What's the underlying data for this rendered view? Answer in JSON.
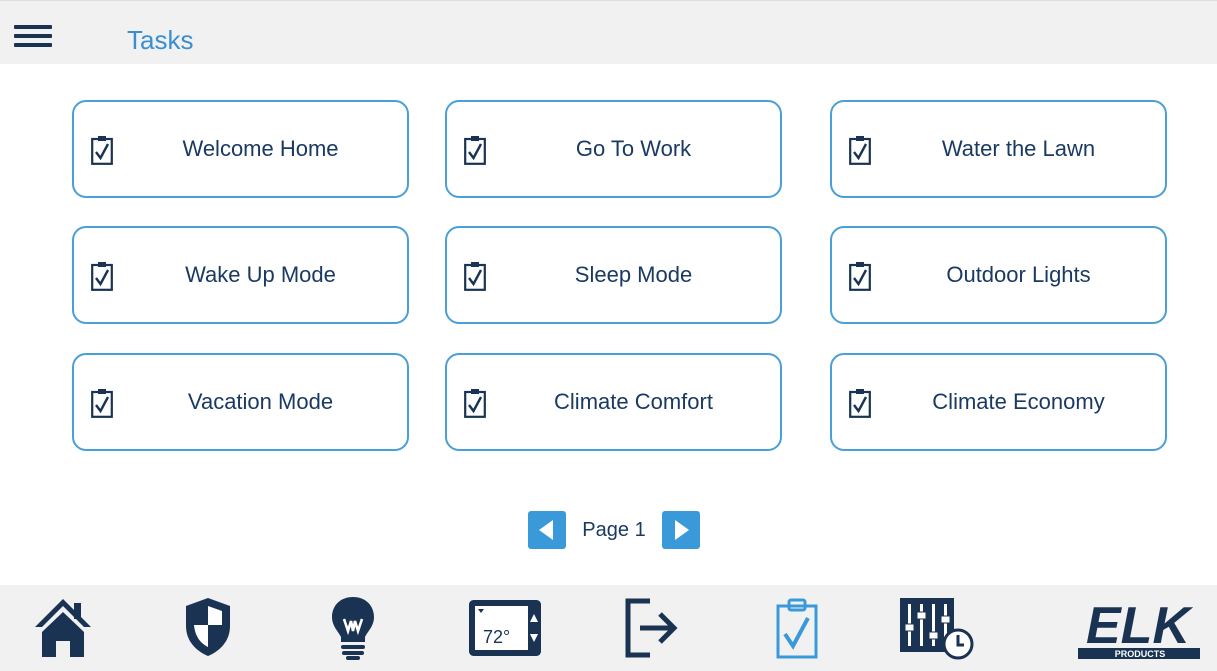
{
  "header": {
    "title": "Tasks"
  },
  "tasks": [
    {
      "label": "Welcome Home"
    },
    {
      "label": "Go To Work"
    },
    {
      "label": "Water the Lawn"
    },
    {
      "label": "Wake Up Mode"
    },
    {
      "label": "Sleep Mode"
    },
    {
      "label": "Outdoor Lights"
    },
    {
      "label": "Vacation Mode"
    },
    {
      "label": "Climate Comfort"
    },
    {
      "label": "Climate Economy"
    }
  ],
  "pager": {
    "label": "Page 1"
  },
  "bottom_nav": {
    "items": [
      "home-icon",
      "security-shield-icon",
      "lightbulb-icon",
      "thermostat-icon",
      "exit-arrow-icon",
      "tasks-clipboard-icon",
      "automation-schedule-icon"
    ],
    "thermostat_temp": "72°",
    "active_item": "tasks-clipboard-icon"
  },
  "logo": {
    "brand": "ELK",
    "sub": "PRODUCTS"
  },
  "colors": {
    "accent": "#3a9ad9",
    "dark_navy": "#1a3353",
    "text": "#1a3a62",
    "button_border": "#4a9fd8"
  }
}
